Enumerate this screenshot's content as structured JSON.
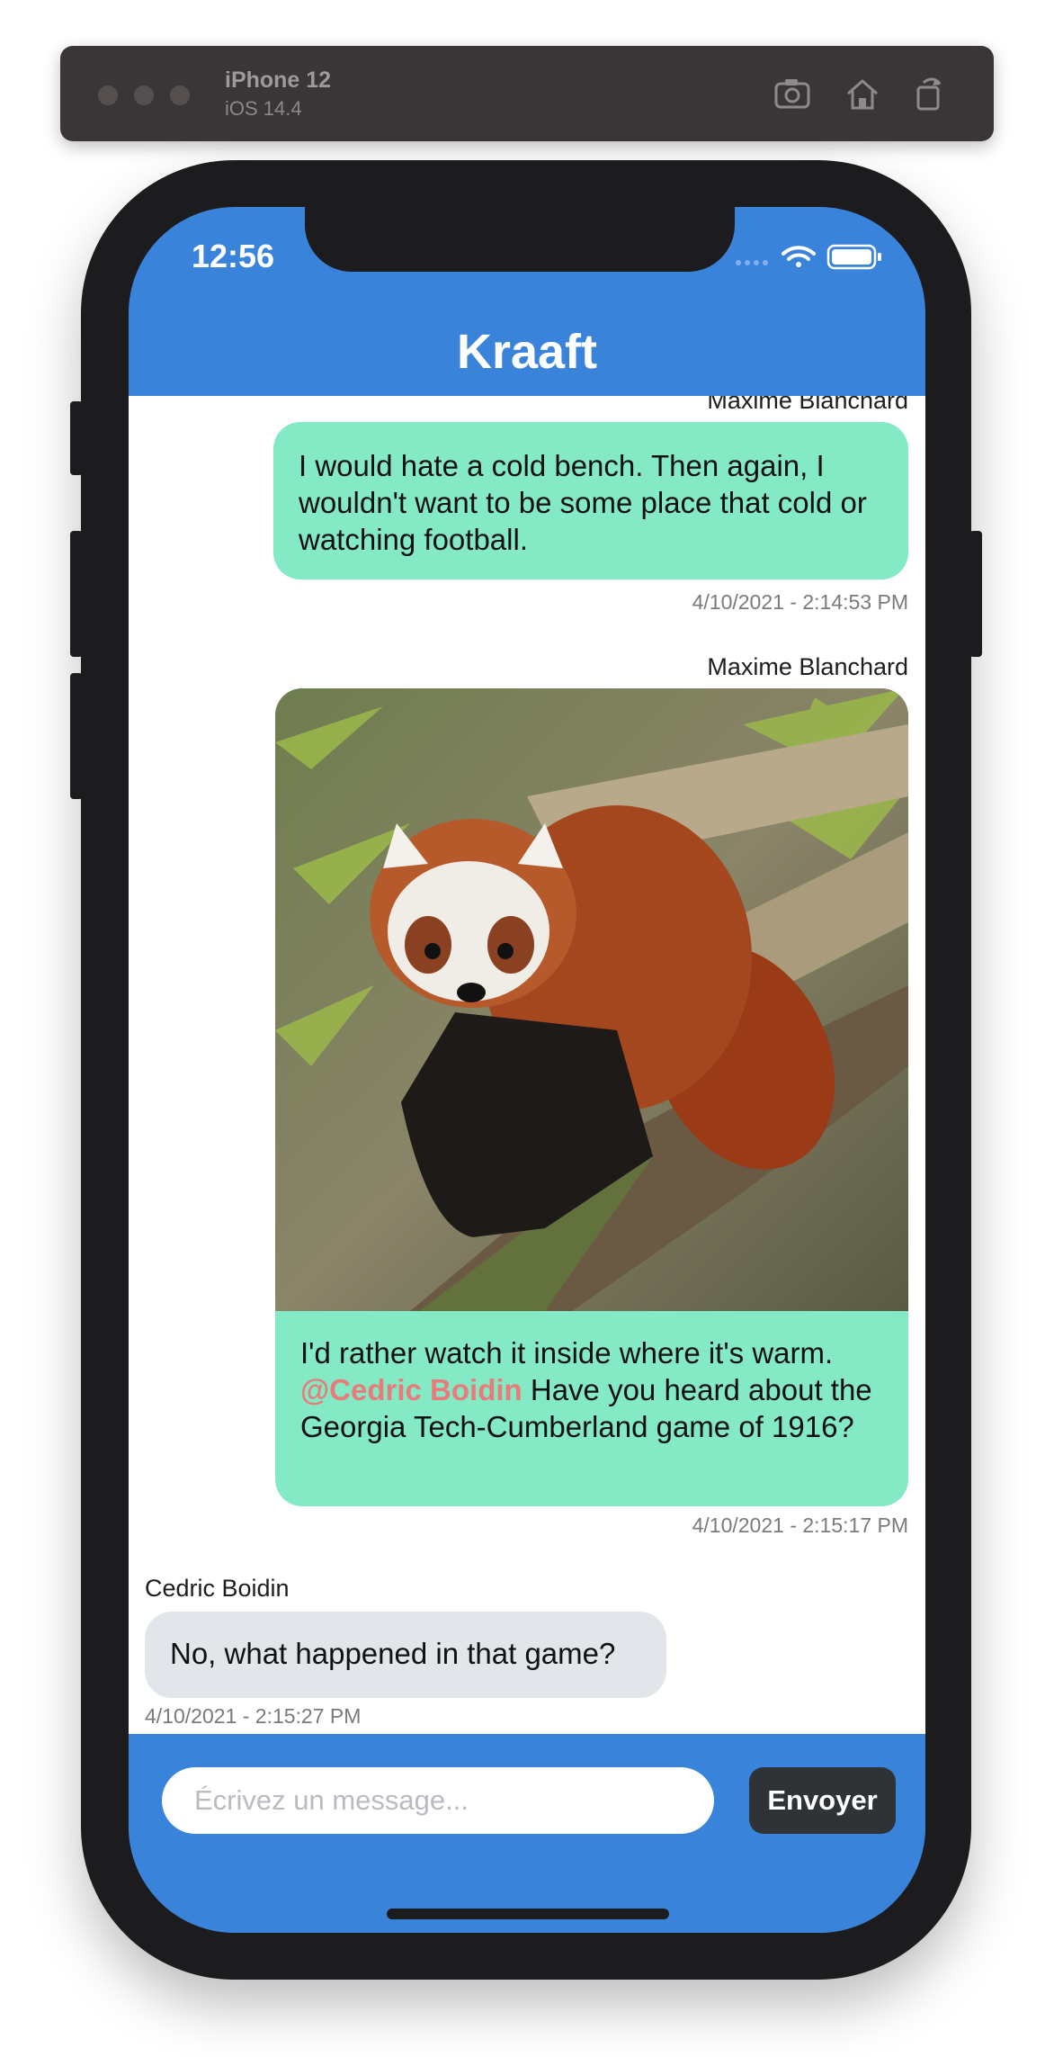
{
  "simulator": {
    "device_name": "iPhone 12",
    "os_version": "iOS 14.4",
    "icons": [
      "screenshot-icon",
      "home-icon",
      "rotate-icon"
    ]
  },
  "status_bar": {
    "time": "12:56",
    "icons": [
      "cellular-icon",
      "wifi-icon",
      "battery-icon"
    ]
  },
  "header": {
    "title": "Kraaft"
  },
  "messages": [
    {
      "sender": "Maxime Blanchard",
      "text": "I would hate a cold bench. Then again, I wouldn't want to be some place that cold or watching football.",
      "timestamp": "4/10/2021 - 2:14:53 PM"
    },
    {
      "sender": "Maxime Blanchard",
      "image": "red-panda-photo",
      "text_before": "I'd rather watch it inside where it's warm.",
      "mention": "@Cedric Boidin",
      "text_after": "Have you heard about the Georgia Tech-Cumberland game of 1916?",
      "timestamp": "4/10/2021 - 2:15:17 PM"
    },
    {
      "sender": "Cedric Boidin",
      "text": "No, what happened in that game?",
      "timestamp": "4/10/2021 - 2:15:27 PM"
    }
  ],
  "composer": {
    "placeholder": "Écrivez un message...",
    "value": "",
    "send_label": "Envoyer"
  },
  "colors": {
    "brand_blue": "#3a83db",
    "my_bubble": "#84e9c5",
    "their_bubble": "#e2e6ea",
    "mention": "#e97b7b",
    "send_button": "#2f3336"
  }
}
